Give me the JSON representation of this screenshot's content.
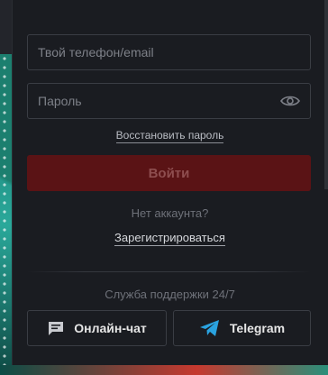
{
  "login": {
    "placeholder": "Твой телефон/email"
  },
  "password": {
    "placeholder": "Пароль",
    "toggle_icon": "eye-icon"
  },
  "restore_password_label": "Восстановить пароль",
  "submit_label": "Войти",
  "no_account_label": "Нет аккаунта?",
  "register_label": "Зарегистрироваться",
  "support": {
    "title": "Служба поддержки 24/7",
    "chat_label": "Онлайн-чат",
    "chat_icon": "chat-icon",
    "telegram_label": "Telegram",
    "telegram_icon": "telegram-icon"
  },
  "colors": {
    "accent": "#5a1315",
    "telegram": "#2aa3e0"
  }
}
